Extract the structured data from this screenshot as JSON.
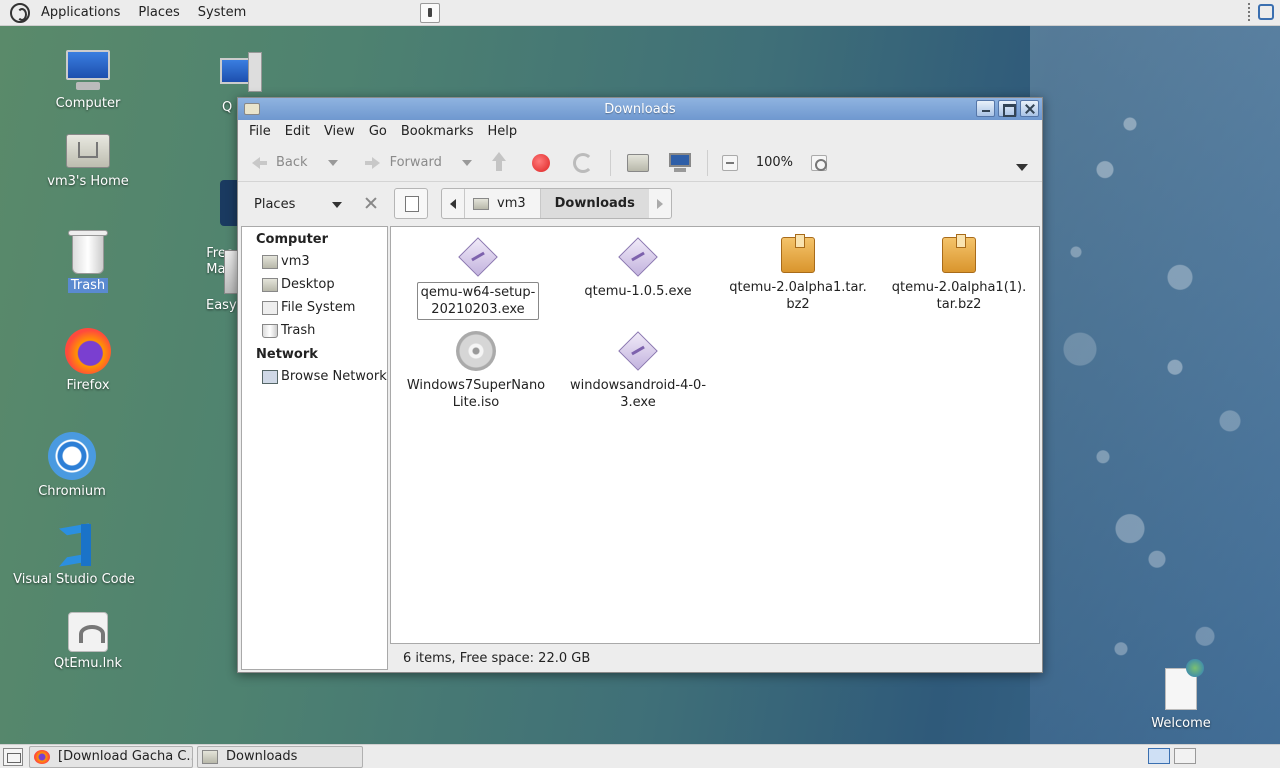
{
  "top_panel": {
    "menus": [
      "Applications",
      "Places",
      "System"
    ]
  },
  "desktop": {
    "icons": [
      {
        "label": "Computer",
        "icon": "computer-icon"
      },
      {
        "label": "vm3's Home",
        "icon": "home-folder-icon"
      },
      {
        "label": "Trash",
        "icon": "trash-icon",
        "selected": true
      },
      {
        "label": "Firefox",
        "icon": "firefox-icon"
      },
      {
        "label": "Chromium",
        "icon": "chromium-icon"
      },
      {
        "label": "Visual Studio Code",
        "icon": "vscode-icon"
      },
      {
        "label": "QtEmu.lnk",
        "icon": "qtemu-shortcut-icon"
      }
    ],
    "partial_icons": [
      {
        "label": "Q",
        "icon": "qt-computer-icon"
      },
      {
        "label": "Free D\nMa",
        "icon": "free-download-manager-icon"
      },
      {
        "label": "Easy",
        "icon": "easy-app-icon"
      }
    ],
    "welcome": {
      "label": "Welcome",
      "icon": "welcome-doc-icon"
    }
  },
  "window": {
    "title": "Downloads",
    "menu": [
      "File",
      "Edit",
      "View",
      "Go",
      "Bookmarks",
      "Help"
    ],
    "toolbar": {
      "back_label": "Back",
      "forward_label": "Forward",
      "zoom": "100%"
    },
    "location": {
      "places_label": "Places",
      "crumbs": [
        "vm3",
        "Downloads"
      ]
    },
    "sidebar": {
      "sections": [
        {
          "heading": "Computer",
          "items": [
            {
              "label": "vm3",
              "icon": "home-folder-icon"
            },
            {
              "label": "Desktop",
              "icon": "desktop-folder-icon"
            },
            {
              "label": "File System",
              "icon": "filesystem-icon"
            },
            {
              "label": "Trash",
              "icon": "trash-icon"
            }
          ]
        },
        {
          "heading": "Network",
          "items": [
            {
              "label": "Browse Network",
              "icon": "network-icon"
            }
          ]
        }
      ]
    },
    "files": [
      {
        "name": "qemu-w64-setup-\n20210203.exe",
        "type": "exe",
        "selected": true
      },
      {
        "name": "qtemu-1.0.5.exe",
        "type": "exe"
      },
      {
        "name": "qtemu-2.0alpha1.tar.\nbz2",
        "type": "tar"
      },
      {
        "name": "qtemu-2.0alpha1(1).\ntar.bz2",
        "type": "tar"
      },
      {
        "name": "Windows7SuperNano\nLite.iso",
        "type": "iso"
      },
      {
        "name": "windowsandroid-4-0-\n3.exe",
        "type": "exe"
      }
    ],
    "status": "6 items, Free space: 22.0 GB"
  },
  "taskbar": {
    "tasks": [
      {
        "label": "[Download Gacha C...",
        "icon": "firefox-icon"
      },
      {
        "label": "Downloads",
        "icon": "folder-icon"
      }
    ]
  }
}
